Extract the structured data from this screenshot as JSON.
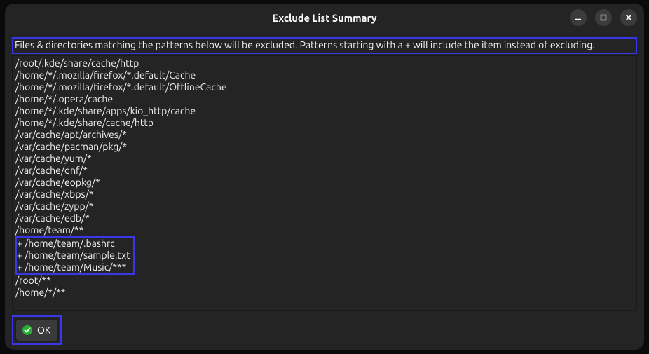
{
  "window": {
    "title": "Exclude List Summary"
  },
  "info": {
    "text": "Files & directories matching the patterns below will be excluded. Patterns starting with a + will include the item instead of excluding."
  },
  "patterns": {
    "pre": [
      "/root/.kde/share/cache/http",
      "/home/*/.mozilla/firefox/*.default/Cache",
      "/home/*/.mozilla/firefox/*.default/OfflineCache",
      "/home/*/.opera/cache",
      "/home/*/.kde/share/apps/kio_http/cache",
      "/home/*/.kde/share/cache/http",
      "/var/cache/apt/archives/*",
      "/var/cache/pacman/pkg/*",
      "/var/cache/yum/*",
      "/var/cache/dnf/*",
      "/var/cache/eopkg/*",
      "/var/cache/xbps/*",
      "/var/cache/zypp/*",
      "/var/cache/edb/*",
      "/home/team/**"
    ],
    "highlighted": [
      "+ /home/team/.bashrc",
      "+ /home/team/sample.txt",
      "+ /home/team/Music/***"
    ],
    "post": [
      "/root/**",
      "/home/*/**"
    ]
  },
  "buttons": {
    "ok": "OK"
  },
  "icons": {
    "minimize": "minimize",
    "maximize": "maximize",
    "close": "close",
    "ok": "check"
  }
}
